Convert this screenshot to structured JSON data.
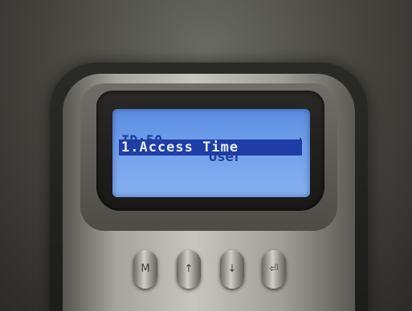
{
  "display": {
    "row1": {
      "id_text": "ID:50",
      "role": "User",
      "signal_icon": "signal-icon"
    },
    "row2": {
      "selected_item": "1.Access Time"
    }
  },
  "keypad": {
    "keys": [
      {
        "icon": "menu-key-icon",
        "glyph": "M"
      },
      {
        "icon": "up-arrow-icon",
        "glyph": "↑"
      },
      {
        "icon": "down-arrow-icon",
        "glyph": "↓"
      },
      {
        "icon": "ok-key-icon",
        "glyph": "⏎"
      }
    ]
  },
  "colors": {
    "lcd_background": "#6f9eea",
    "lcd_text": "#1f3f9b",
    "highlight_bar": "#1e3da6",
    "highlight_text": "#e7efff"
  }
}
